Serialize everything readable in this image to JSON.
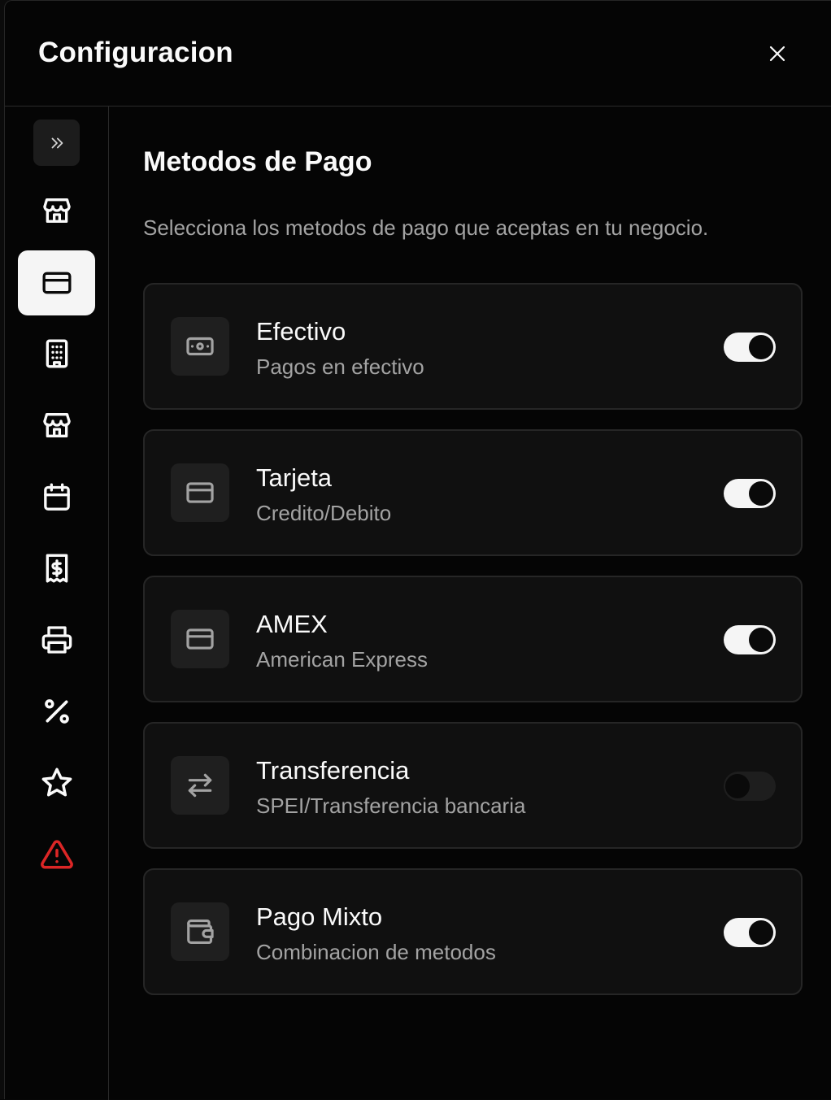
{
  "dialog": {
    "title": "Configuracion",
    "close_icon": "close-icon"
  },
  "sidebar": {
    "expand_icon": "chevrons-right-icon",
    "items": [
      {
        "icon": "store-icon",
        "active": false
      },
      {
        "icon": "credit-card-icon",
        "active": true
      },
      {
        "icon": "building-icon",
        "active": false
      },
      {
        "icon": "store-icon",
        "active": false
      },
      {
        "icon": "calendar-icon",
        "active": false
      },
      {
        "icon": "receipt-dollar-icon",
        "active": false
      },
      {
        "icon": "printer-icon",
        "active": false
      },
      {
        "icon": "percent-icon",
        "active": false
      },
      {
        "icon": "star-icon",
        "active": false
      },
      {
        "icon": "alert-triangle-icon",
        "active": false,
        "color": "#dc2626"
      }
    ]
  },
  "section": {
    "title": "Metodos de Pago",
    "description": "Selecciona los metodos de pago que aceptas en tu negocio."
  },
  "payment_methods": [
    {
      "icon": "banknote-icon",
      "title": "Efectivo",
      "subtitle": "Pagos en efectivo",
      "enabled": true
    },
    {
      "icon": "credit-card-icon",
      "title": "Tarjeta",
      "subtitle": "Credito/Debito",
      "enabled": true
    },
    {
      "icon": "credit-card-icon",
      "title": "AMEX",
      "subtitle": "American Express",
      "enabled": true
    },
    {
      "icon": "transfer-arrows-icon",
      "title": "Transferencia",
      "subtitle": "SPEI/Transferencia bancaria",
      "enabled": false
    },
    {
      "icon": "wallet-icon",
      "title": "Pago Mixto",
      "subtitle": "Combinacion de metodos",
      "enabled": true
    }
  ],
  "colors": {
    "background": "#050505",
    "card": "#101010",
    "accent": "#f5f5f5",
    "muted_text": "#a3a3a3",
    "danger": "#dc2626"
  }
}
